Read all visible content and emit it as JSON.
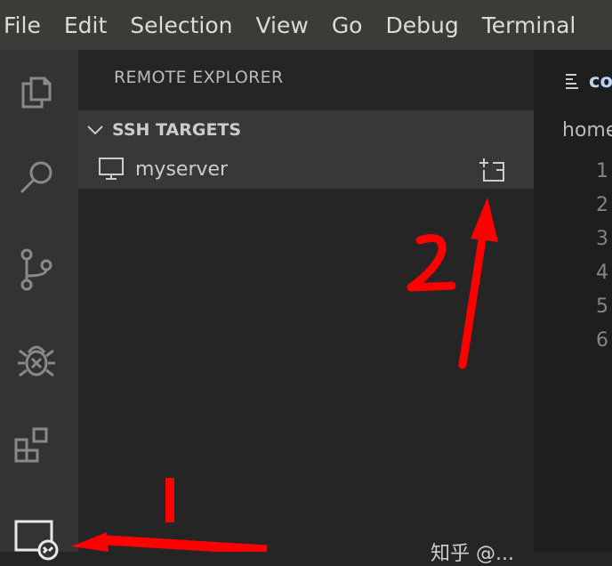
{
  "menubar": {
    "items": [
      "File",
      "Edit",
      "Selection",
      "View",
      "Go",
      "Debug",
      "Terminal"
    ]
  },
  "activity_bar": {
    "items": [
      {
        "name": "explorer",
        "icon": "files-icon"
      },
      {
        "name": "search",
        "icon": "search-icon"
      },
      {
        "name": "source-control",
        "icon": "source-control-icon"
      },
      {
        "name": "debug",
        "icon": "debug-icon"
      },
      {
        "name": "extensions",
        "icon": "extensions-icon"
      },
      {
        "name": "remote-explorer",
        "icon": "remote-explorer-icon",
        "active": true
      }
    ]
  },
  "sidebar": {
    "title": "REMOTE EXPLORER",
    "section": {
      "header": "SSH TARGETS",
      "expanded": true,
      "targets": [
        {
          "label": "myserver",
          "icon": "monitor-icon",
          "action_icon": "connect-new-window-icon"
        }
      ]
    }
  },
  "editor": {
    "tab_label": "co",
    "breadcrumb": "home",
    "line_numbers": [
      "1",
      "2",
      "3",
      "4",
      "5",
      "6"
    ]
  },
  "annotations": {
    "label_1": "1",
    "label_2": "2",
    "color": "#ff0000"
  },
  "watermark": "知乎 @..."
}
